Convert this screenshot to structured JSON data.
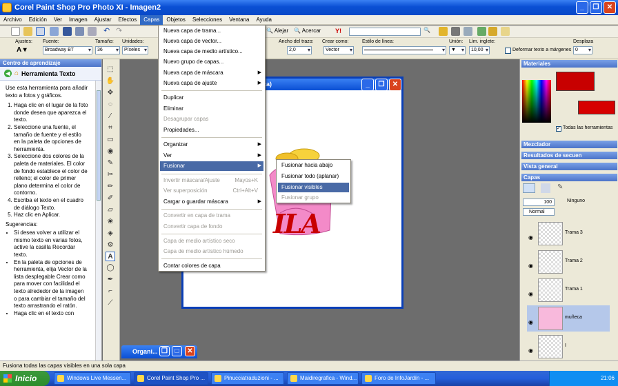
{
  "window": {
    "title": "Corel Paint Shop Pro Photo XI - Imagen2"
  },
  "menubar": [
    "Archivo",
    "Edición",
    "Ver",
    "Imagen",
    "Ajustar",
    "Efectos",
    "Capas",
    "Objetos",
    "Selecciones",
    "Ventana",
    "Ayuda"
  ],
  "toolbar": {
    "zoom_out": "Alejar",
    "zoom_in": "Acercar"
  },
  "options": {
    "ajustes_label": "Ajustes:",
    "fuente_label": "Fuente:",
    "fuente_value": "Broadway BT",
    "tamano_label": "Tamaño:",
    "tamano_value": "36",
    "unidades_label": "Unidades:",
    "unidades_value": "Píxeles",
    "ancho_label": "Ancho del trazo:",
    "ancho_value": "2,0",
    "crear_label": "Crear como:",
    "crear_value": "Vector",
    "estilo_label": "Estilo de línea:",
    "union_label": "Unión:",
    "lim_label": "Lím. inglete:",
    "lim_value": "10,00",
    "deformar_label": "Deformar texto a márgenes",
    "desplaz_label": "Desplaza",
    "desplaz_value": "0"
  },
  "learning": {
    "header": "Centro de aprendizaje",
    "tool": "Herramienta Texto",
    "intro": "Use esta herramienta para añadir texto a fotos y gráficos.",
    "steps": [
      "Haga clic en el lugar de la foto donde desea que aparezca el texto.",
      "Seleccione una fuente, el tamaño de fuente y el estilo en la paleta de opciones de herramienta.",
      "Seleccione dos colores de la paleta de materiales. El color de fondo establece el color de relleno; el color de primer plano determina el color de contorno.",
      "Escriba el texto en el cuadro de diálogo Texto.",
      "Haz clic en Aplicar."
    ],
    "sug_label": "Sugerencias:",
    "tips": [
      "Si desea volver a utilizar el mismo texto en varias fotos, active la casilla Recordar texto.",
      "En la paleta de opciones de herramienta, elija Vector de la lista desplegable Crear como para mover con facilidad el texto alrededor de la imagen o para cambiar el tamaño del texto arrastrando el ratón.",
      "Haga clic en el texto con"
    ]
  },
  "document": {
    "title_fragment": "eca)",
    "artwork_text": "ILA",
    "minimized_title": "Organi..."
  },
  "capas_menu": [
    {
      "label": "Nueva capa de trama...",
      "disabled": false
    },
    {
      "label": "Nueva capa de vector...",
      "disabled": false
    },
    {
      "label": "Nueva capa de medio artístico...",
      "disabled": false
    },
    {
      "label": "Nuevo grupo de capas...",
      "disabled": false
    },
    {
      "label": "Nueva capa de máscara",
      "disabled": false,
      "sub": true
    },
    {
      "label": "Nueva capa de ajuste",
      "disabled": false,
      "sub": true
    },
    {
      "label": "Duplicar",
      "disabled": false
    },
    {
      "label": "Eliminar",
      "disabled": false
    },
    {
      "label": "Desagrupar capas",
      "disabled": true
    },
    {
      "label": "Propiedades...",
      "disabled": false
    },
    {
      "label": "Organizar",
      "disabled": false,
      "sub": true
    },
    {
      "label": "Ver",
      "disabled": false,
      "sub": true
    },
    {
      "label": "Fusionar",
      "disabled": false,
      "sub": true,
      "highlight": true
    },
    {
      "label": "Invertir máscara/Ajuste",
      "disabled": true,
      "shortcut": "Mayús+K"
    },
    {
      "label": "Ver superposición",
      "disabled": true,
      "shortcut": "Ctrl+Alt+V"
    },
    {
      "label": "Cargar o guardar máscara",
      "disabled": false,
      "sub": true
    },
    {
      "label": "Convertir en capa de trama",
      "disabled": true
    },
    {
      "label": "Convertir capa de fondo",
      "disabled": true
    },
    {
      "label": "Capa de medio artístico seco",
      "disabled": true
    },
    {
      "label": "Capa de medio artístico húmedo",
      "disabled": true
    },
    {
      "label": "Contar colores de capa",
      "disabled": false
    }
  ],
  "fusionar_menu": [
    {
      "label": "Fusionar hacia abajo",
      "disabled": false
    },
    {
      "label": "Fusionar todo (aplanar)",
      "disabled": false
    },
    {
      "label": "Fusionar visibles",
      "disabled": false,
      "highlight": true
    },
    {
      "label": "Fusionar grupo",
      "disabled": true
    }
  ],
  "right": {
    "materiales": "Materiales",
    "todas": "Todas las herramientas",
    "mezclador": "Mezclador",
    "resultados": "Resultados de secuen",
    "vista": "Vista general",
    "capas": "Capas",
    "opacity": "100",
    "blend": "Normal",
    "ninguno": "Ninguno",
    "layers": [
      "Trama 3",
      "Trama 2",
      "Trama 1",
      "muñeca",
      "I"
    ]
  },
  "status": "Fusiona todas las capas visibles en una sola capa",
  "taskbar": {
    "start": "Inicio",
    "tasks": [
      "Windows Live Messen...",
      "Corel Paint Shop Pro ...",
      "Pinucciatraduzioni - ...",
      "Maidiregrafica - Wind...",
      "Foro de InfoJardín - ..."
    ],
    "clock": "21:06"
  },
  "colors": {
    "accent": "#0a4fd4",
    "fg_color": "#c80000",
    "menu_highlight": "#496aa6"
  }
}
